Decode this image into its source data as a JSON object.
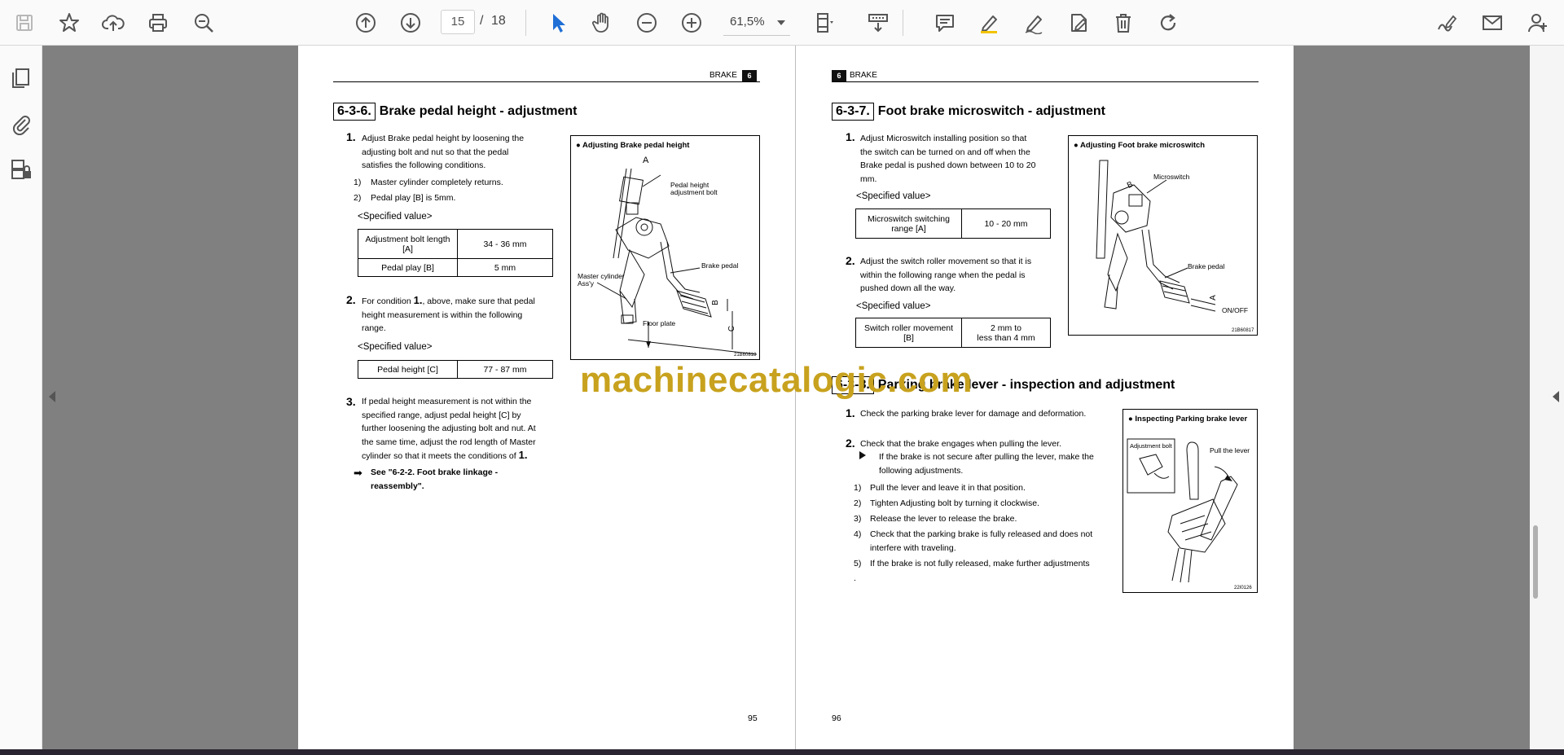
{
  "toolbar": {
    "page_current": "15",
    "page_separator": "/",
    "page_total": "18",
    "zoom": "61,5%"
  },
  "colors": {
    "accent": "#1f6fd6",
    "watermark": "#c8a21e",
    "toolbar_icon": "#555555"
  },
  "watermark": "machinecatalogic.com",
  "left_page": {
    "header_title": "BRAKE",
    "header_chapter": "6",
    "section_number": "6-3-6.",
    "section_title": "Brake pedal height - adjustment",
    "step1_num": "1.",
    "step1_lines": [
      "Adjust Brake pedal height by loosening the",
      "adjusting bolt and nut so that the pedal",
      "satisfies the following conditions."
    ],
    "sub1_num": "1)",
    "sub1": "Master cylinder completely returns.",
    "sub2_num": "2)",
    "sub2": "Pedal play [B] is 5mm.",
    "spec_label_1": "<Specified value>",
    "table1": [
      {
        "param_line1": "Adjustment bolt length",
        "param_line2": "[A]",
        "value": "34 - 36 mm"
      },
      {
        "param_line1": "Pedal play [B]",
        "param_line2": "",
        "value": "5 mm"
      }
    ],
    "step2_num": "2.",
    "step2_pre": "For condition ",
    "step2_ref": "1.",
    "step2_post": ", above, make sure that pedal",
    "step2_lines": [
      "height measurement is within the following",
      "range."
    ],
    "spec_label_2": "<Specified value>",
    "table2": [
      {
        "param": "Pedal height [C]",
        "value": "77 - 87 mm"
      }
    ],
    "step3_num": "3.",
    "step3_lines": [
      "If pedal height measurement is not within the",
      "specified range, adjust pedal height [C] by",
      "further loosening the adjusting bolt and nut. At",
      "the same time, adjust the rod length of Master"
    ],
    "step3_last_pre": "cylinder so that it meets the conditions of ",
    "step3_last_ref": "1.",
    "see_line1": "See \"6-2-2. Foot brake linkage -",
    "see_line2": "reassembly\".",
    "figure": {
      "title": "Adjusting Brake pedal height",
      "label_a": "A",
      "label_b": "B",
      "label_c": "C",
      "label_bolt_1": "Pedal height",
      "label_bolt_2": "adjustment bolt",
      "label_pedal": "Brake pedal",
      "label_mc_1": "Master cylinder",
      "label_mc_2": "Ass'y",
      "label_floor": "Floor plate",
      "code": "21B60818"
    },
    "page_number": "95"
  },
  "right_page": {
    "header_chapter": "6",
    "header_title": "BRAKE",
    "section_number": "6-3-7.",
    "section_title": "Foot brake microswitch - adjustment",
    "step1_num": "1.",
    "step1_lines": [
      "Adjust Microswitch installing position so that",
      "the switch can be turned on and off when the",
      "Brake pedal is pushed down between 10 to 20",
      "mm."
    ],
    "spec_label_1": "<Specified value>",
    "table1": [
      {
        "param_line1": "Microswitch switching",
        "param_line2": "range [A]",
        "value_line1": "10 - 20 mm",
        "value_line2": ""
      }
    ],
    "step2_num": "2.",
    "step2_lines": [
      "Adjust the switch roller movement so that it is",
      "within the following range when the pedal is",
      "pushed down all the way."
    ],
    "spec_label_2": "<Specified value>",
    "table2": [
      {
        "param_line1": "Switch roller movement [B]",
        "param_line2": "",
        "value_line1": "2 mm to",
        "value_line2": "less than 4 mm"
      }
    ],
    "figure1": {
      "title": "Adjusting Foot brake microswitch",
      "label_b": "B",
      "label_a": "A",
      "label_micro": "Microswitch",
      "label_pedal": "Brake pedal",
      "label_onoff": "ON/OFF",
      "code": "21B60817"
    },
    "section2_number": "6-3-8.",
    "section2_title": "Parking brake lever - inspection and adjustment",
    "p_step1_num": "1.",
    "p_step1": "Check the parking brake lever for damage and deformation.",
    "p_step2_num": "2.",
    "p_step2": "Check that the brake engages when pulling the lever.",
    "p_note_lines": [
      "If the brake is not secure after pulling the lever, make the",
      "following adjustments."
    ],
    "p_subs": [
      {
        "num": "1)",
        "lines": [
          "Pull the lever and leave it in that position."
        ]
      },
      {
        "num": "2)",
        "lines": [
          "Tighten Adjusting bolt by turning it clockwise."
        ]
      },
      {
        "num": "3)",
        "lines": [
          "Release the lever to release the brake."
        ]
      },
      {
        "num": "4)",
        "lines": [
          "Check that the parking brake is fully released and does not",
          "interfere with traveling."
        ]
      },
      {
        "num": "5)",
        "lines": [
          "If the brake is not fully released, make further adjustments"
        ]
      }
    ],
    "p_trailing": ".",
    "figure2": {
      "title": "Inspecting Parking brake lever",
      "label_bolt": "Adjustment bolt",
      "label_pull": "Pull the lever",
      "code": "22I0126"
    },
    "page_number": "96"
  }
}
